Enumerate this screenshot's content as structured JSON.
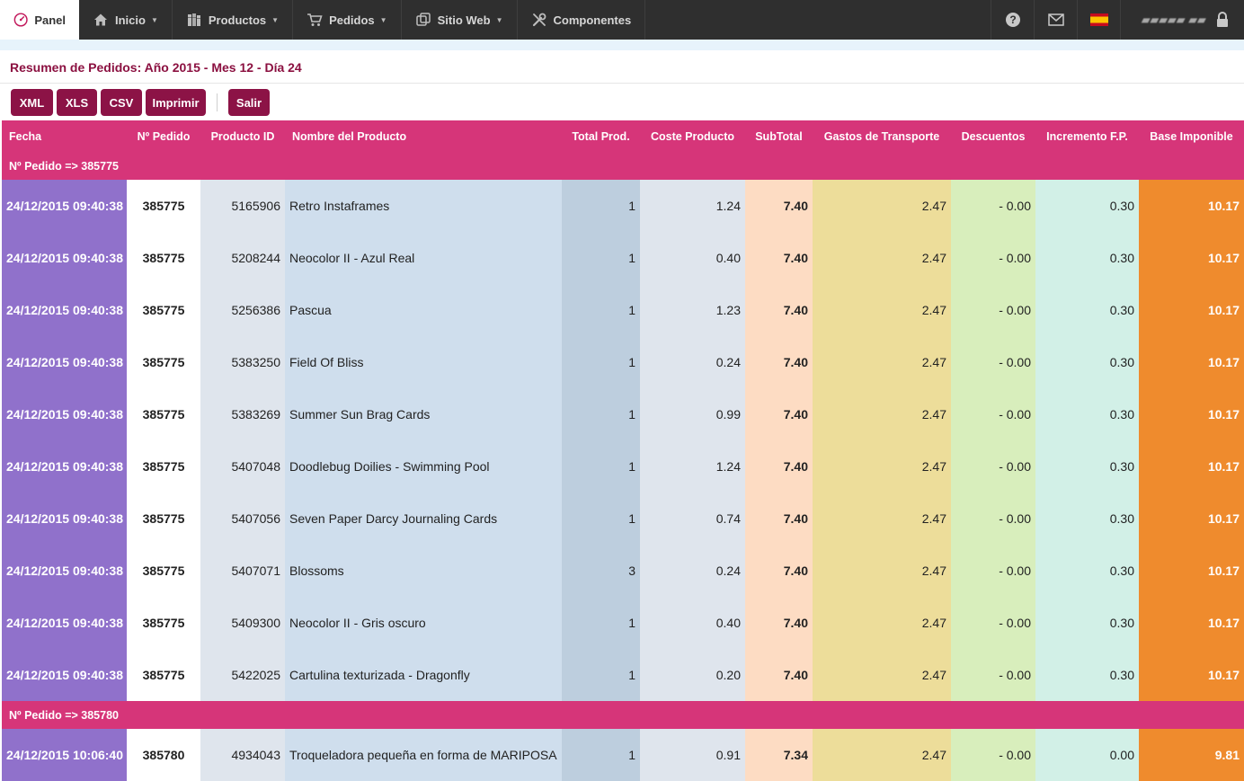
{
  "nav": {
    "panel": "Panel",
    "items": [
      {
        "label": "Inicio",
        "icon": "home-icon",
        "dropdown": true
      },
      {
        "label": "Productos",
        "icon": "books-icon",
        "dropdown": true
      },
      {
        "label": "Pedidos",
        "icon": "cart-icon",
        "dropdown": true
      },
      {
        "label": "Sitio Web",
        "icon": "windows-icon",
        "dropdown": true
      },
      {
        "label": "Componentes",
        "icon": "tools-icon",
        "dropdown": false
      }
    ],
    "right_icons": [
      "help-icon",
      "mail-icon",
      "spain-flag-icon",
      "lock-icon"
    ]
  },
  "page": {
    "title": "Resumen de Pedidos: Año 2015 - Mes 12 - Día 24"
  },
  "toolbar": {
    "xml": "XML",
    "xls": "XLS",
    "csv": "CSV",
    "print": "Imprimir",
    "exit": "Salir"
  },
  "table": {
    "headers": [
      "Fecha",
      "Nº Pedido",
      "Producto ID",
      "Nombre del Producto",
      "Total Prod.",
      "Coste Producto",
      "SubTotal",
      "Gastos de Transporte",
      "Descuentos",
      "Incremento F.P.",
      "Base Imponible"
    ],
    "groups": [
      {
        "label": "Nº Pedido => 385775",
        "rows": [
          [
            "24/12/2015 09:40:38",
            "385775",
            "5165906",
            "Retro Instaframes",
            "1",
            "1.24",
            "7.40",
            "2.47",
            "- 0.00",
            "0.30",
            "10.17"
          ],
          [
            "24/12/2015 09:40:38",
            "385775",
            "5208244",
            "Neocolor II - Azul Real",
            "1",
            "0.40",
            "7.40",
            "2.47",
            "- 0.00",
            "0.30",
            "10.17"
          ],
          [
            "24/12/2015 09:40:38",
            "385775",
            "5256386",
            "Pascua",
            "1",
            "1.23",
            "7.40",
            "2.47",
            "- 0.00",
            "0.30",
            "10.17"
          ],
          [
            "24/12/2015 09:40:38",
            "385775",
            "5383250",
            "Field Of Bliss",
            "1",
            "0.24",
            "7.40",
            "2.47",
            "- 0.00",
            "0.30",
            "10.17"
          ],
          [
            "24/12/2015 09:40:38",
            "385775",
            "5383269",
            "Summer Sun Brag Cards",
            "1",
            "0.99",
            "7.40",
            "2.47",
            "- 0.00",
            "0.30",
            "10.17"
          ],
          [
            "24/12/2015 09:40:38",
            "385775",
            "5407048",
            "Doodlebug Doilies - Swimming Pool",
            "1",
            "1.24",
            "7.40",
            "2.47",
            "- 0.00",
            "0.30",
            "10.17"
          ],
          [
            "24/12/2015 09:40:38",
            "385775",
            "5407056",
            "Seven Paper Darcy Journaling Cards",
            "1",
            "0.74",
            "7.40",
            "2.47",
            "- 0.00",
            "0.30",
            "10.17"
          ],
          [
            "24/12/2015 09:40:38",
            "385775",
            "5407071",
            "Blossoms",
            "3",
            "0.24",
            "7.40",
            "2.47",
            "- 0.00",
            "0.30",
            "10.17"
          ],
          [
            "24/12/2015 09:40:38",
            "385775",
            "5409300",
            "Neocolor II - Gris oscuro",
            "1",
            "0.40",
            "7.40",
            "2.47",
            "- 0.00",
            "0.30",
            "10.17"
          ],
          [
            "24/12/2015 09:40:38",
            "385775",
            "5422025",
            "Cartulina texturizada - Dragonfly",
            "1",
            "0.20",
            "7.40",
            "2.47",
            "- 0.00",
            "0.30",
            "10.17"
          ]
        ]
      },
      {
        "label": "Nº Pedido => 385780",
        "rows": [
          [
            "24/12/2015 10:06:40",
            "385780",
            "4934043",
            "Troqueladora pequeña en forma de MARIPOSA",
            "1",
            "0.91",
            "7.34",
            "2.47",
            "- 0.00",
            "0.00",
            "9.81"
          ]
        ]
      }
    ]
  },
  "colors": {
    "nav_bg": "#2f2f2f",
    "accent": "#8c1346",
    "header_row": "#d63579",
    "date_col": "#9071cb",
    "base_col": "#ef8b2d"
  }
}
